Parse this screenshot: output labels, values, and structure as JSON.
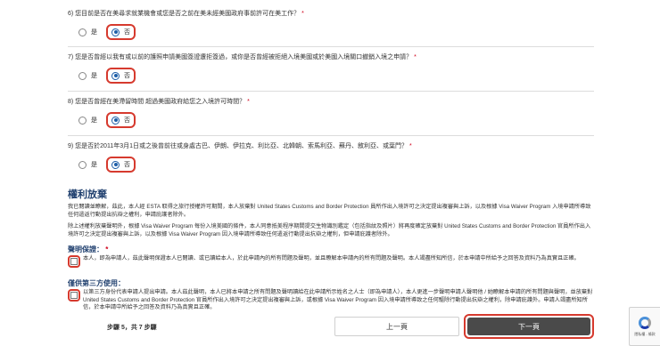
{
  "questions": [
    {
      "text": "6) 您目前是否在美尋求就業機會或您是否之前在美未經美國政府事前許可在美工作？",
      "req": "*",
      "yes": "是",
      "no": "否"
    },
    {
      "text": "7) 您是否曾經以我有或以前的護照申請美國簽證遭拒簽過，或你是否曾經被拒絕入境美國或於美國入境關口撤銷入境之申請？",
      "req": "*",
      "yes": "是",
      "no": "否"
    },
    {
      "text": "8) 您是否曾經在美滯留時間 超過美國政府給您之入境許可時間？",
      "req": "*",
      "yes": "是",
      "no": "否"
    },
    {
      "text": "9) 您是否於2011年3月1日或之後曾前往或身處古巴、伊朗、伊拉克、利比亞、北韓朝、索馬利亞、蘇丹、敘利亞、或葉門？",
      "req": "*",
      "yes": "是",
      "no": "否"
    }
  ],
  "rights": {
    "title": "權利放棄",
    "para1": "我已閱讀並瞭解，茲此，本人經 ESTA 取得之旅行授權許可期間，本人放棄對 United States Customs and Border Protection 員所作出入境許可之決定提出複審與上訴，以及根據 Visa Waiver Program 入境申請所導致任何遣返行動提出抗辯之權利，申請庇護者除外。",
    "para2": "除上述權利放棄聲明外，根據 Visa Waiver Program 每份入境美國的條件，本人同意抵美程序期間提交生物識別鑑定（包括指紋及照片）將再度確定放棄對 United States Customs and Border Protection 官員所作出入境許可之決定提出複審與上訴，以及根據 Visa Waiver Program 因入境申請所導致任何遣返行動提出抗辯之權利，但申請庇護者除外。"
  },
  "declaration": {
    "title": "聲明保證：",
    "req": "*",
    "text": "本人，即為申請人，茲此聲明保證本人已閱讀、或已讀給本人，於此申請內的所有問題及聲明，並且瞭解本申請內的所有問題及聲明。本人竭盡所知所信，於本申請中所給予之回答及資料乃為真實且正確。"
  },
  "third_party": {
    "title": "僅供第三方使用：",
    "text": "以第三方身份代表申請人提出申請。本人茲此聲明，本人已將本申請之所有問題及聲明讀給在此申請所示姓名之人士（即為申請人），本人更進一步聲明申請人聲明他 / 她瞭解本申請的所有問題與聲明，並放棄對 United States Customs and Border Protection 官員所作出入境許可之決定提出複審與上訴，或根據 Visa Waiver Program 因入境申請所導致之任何驅除行動提出抗辯之權利，除申請庇護外。申請人竭盡所知所信，於本申請中所給予之回答及資料乃為真實且正確。"
  },
  "footer": {
    "step": "步驟 5，共 7 步驟",
    "prev": "上一頁",
    "next": "下一頁"
  },
  "captcha": {
    "text": "隱私權 - 條款"
  }
}
